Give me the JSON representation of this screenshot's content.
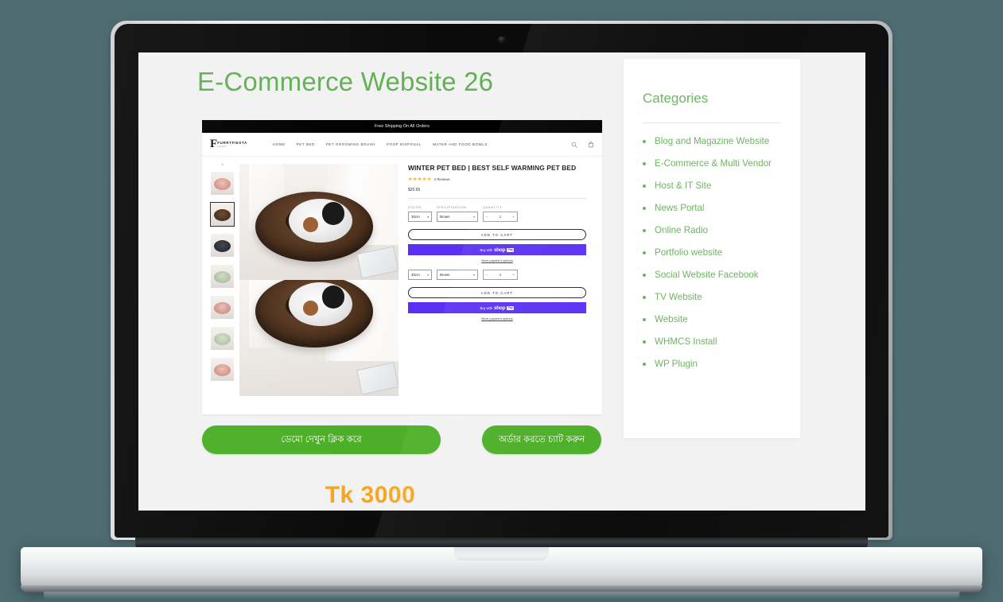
{
  "page": {
    "title": "E-Commerce Website 26",
    "price_label": "Tk 3000",
    "cta_demo": "ডেমো দেখুন ক্লিক করে",
    "cta_order": "অর্ডার করতে চ্যাট করুন",
    "accent_green": "#62b054",
    "cta_green": "#4caf27",
    "price_orange": "#f5a623",
    "background": "#f2f2f2"
  },
  "sidebar": {
    "title": "Categories",
    "items": [
      {
        "label": "Blog and Magazine Website"
      },
      {
        "label": "E-Commerce & Multi Vendor"
      },
      {
        "label": "Host & IT Site"
      },
      {
        "label": "News Portal"
      },
      {
        "label": "Online Radio"
      },
      {
        "label": "Portfolio website"
      },
      {
        "label": "Social Website Facebook"
      },
      {
        "label": "TV Website"
      },
      {
        "label": "Website"
      },
      {
        "label": "WHMCS Install"
      },
      {
        "label": "WP Plugin"
      }
    ]
  },
  "site": {
    "announcement": "Free Shipping On All Orders",
    "logo_mark": "F",
    "logo_text": "FURRYFIESTA",
    "logo_sub": "SHOP",
    "nav": [
      {
        "label": "HOME"
      },
      {
        "label": "PET BED"
      },
      {
        "label": "PET GROOMING BRUSH"
      },
      {
        "label": "POOP DISPOSAL"
      },
      {
        "label": "WATER AND FOOD BOWLS"
      }
    ],
    "header_icons": [
      {
        "name": "search-icon"
      },
      {
        "name": "cart-icon"
      }
    ],
    "thumbnails": [
      {
        "color": "#e0a9a2",
        "selected": false
      },
      {
        "color": "#4a2d18",
        "selected": true
      },
      {
        "color": "#2b2f36",
        "selected": false
      },
      {
        "color": "#b9c9ad",
        "selected": false
      },
      {
        "color": "#e0a9a2",
        "selected": false
      },
      {
        "color": "#b9c9ad",
        "selected": false
      },
      {
        "color": "#e0a9a2",
        "selected": false
      }
    ],
    "product": {
      "title": "WINTER PET BED | BEST SELF WARMING PET BED",
      "stars": "★★★★★",
      "reviews": "2 Reviews",
      "price": "$20.65",
      "options": {
        "color_label": "COLOR",
        "color_value": "30cm",
        "spec_label": "SPECIFICATION",
        "spec_value": "Brown",
        "qty_label": "QUANTITY",
        "qty_value": "1",
        "qty_minus": "−",
        "qty_plus": "+"
      },
      "add_to_cart": "ADD TO CART",
      "shoppay_buy": "Buy with",
      "shoppay_shop": "shop",
      "shoppay_pay": "Pay",
      "more_payment": "More payment options"
    }
  }
}
